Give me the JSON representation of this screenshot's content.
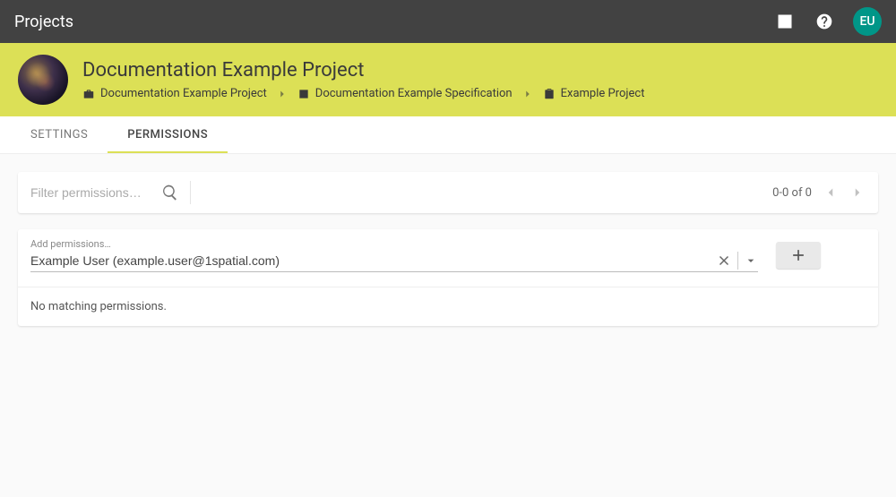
{
  "topbar": {
    "title": "Projects",
    "avatar_initials": "EU"
  },
  "project": {
    "title": "Documentation Example Project"
  },
  "breadcrumbs": [
    {
      "icon": "briefcase",
      "label": "Documentation Example Project"
    },
    {
      "icon": "specification",
      "label": "Documentation Example Specification"
    },
    {
      "icon": "clipboard",
      "label": "Example Project"
    }
  ],
  "tabs": {
    "settings": "SETTINGS",
    "permissions": "PERMISSIONS",
    "active": "permissions"
  },
  "filter": {
    "placeholder": "Filter permissions…",
    "pagination_text": "0-0 of 0"
  },
  "add_permissions": {
    "label": "Add permissions…",
    "value": "Example User (example.user@1spatial.com)"
  },
  "empty_state": "No matching permissions."
}
